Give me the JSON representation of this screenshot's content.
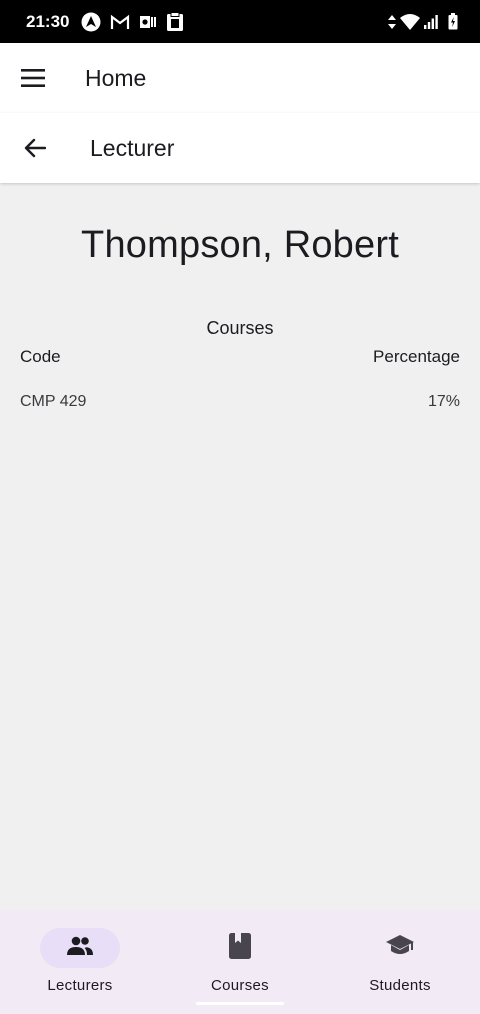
{
  "status_bar": {
    "time": "21:30",
    "left_icons": [
      "android-auto-icon",
      "gmail-icon",
      "outlook-icon",
      "clipboard-icon"
    ],
    "right_icons": [
      "data-arrows-icon",
      "wifi-icon",
      "signal-icon",
      "battery-icon"
    ]
  },
  "app_bar": {
    "title": "Home",
    "menu_icon": "hamburger-menu-icon"
  },
  "sub_bar": {
    "title": "Lecturer",
    "back_icon": "arrow-back-icon"
  },
  "lecturer": {
    "name": "Thompson, Robert"
  },
  "courses": {
    "heading": "Courses",
    "columns": {
      "code": "Code",
      "percentage": "Percentage"
    },
    "rows": [
      {
        "code": "CMP 429",
        "percentage": "17%"
      }
    ]
  },
  "bottom_nav": {
    "items": [
      {
        "label": "Lecturers",
        "icon": "people-icon",
        "active": true
      },
      {
        "label": "Courses",
        "icon": "book-icon",
        "active": false
      },
      {
        "label": "Students",
        "icon": "graduation-cap-icon",
        "active": false
      }
    ]
  },
  "colors": {
    "background": "#f1f0f1",
    "surface": "#ffffff",
    "nav_background": "#f2ebf5",
    "active_pill": "#e8def8",
    "text": "#1c1b1f"
  }
}
